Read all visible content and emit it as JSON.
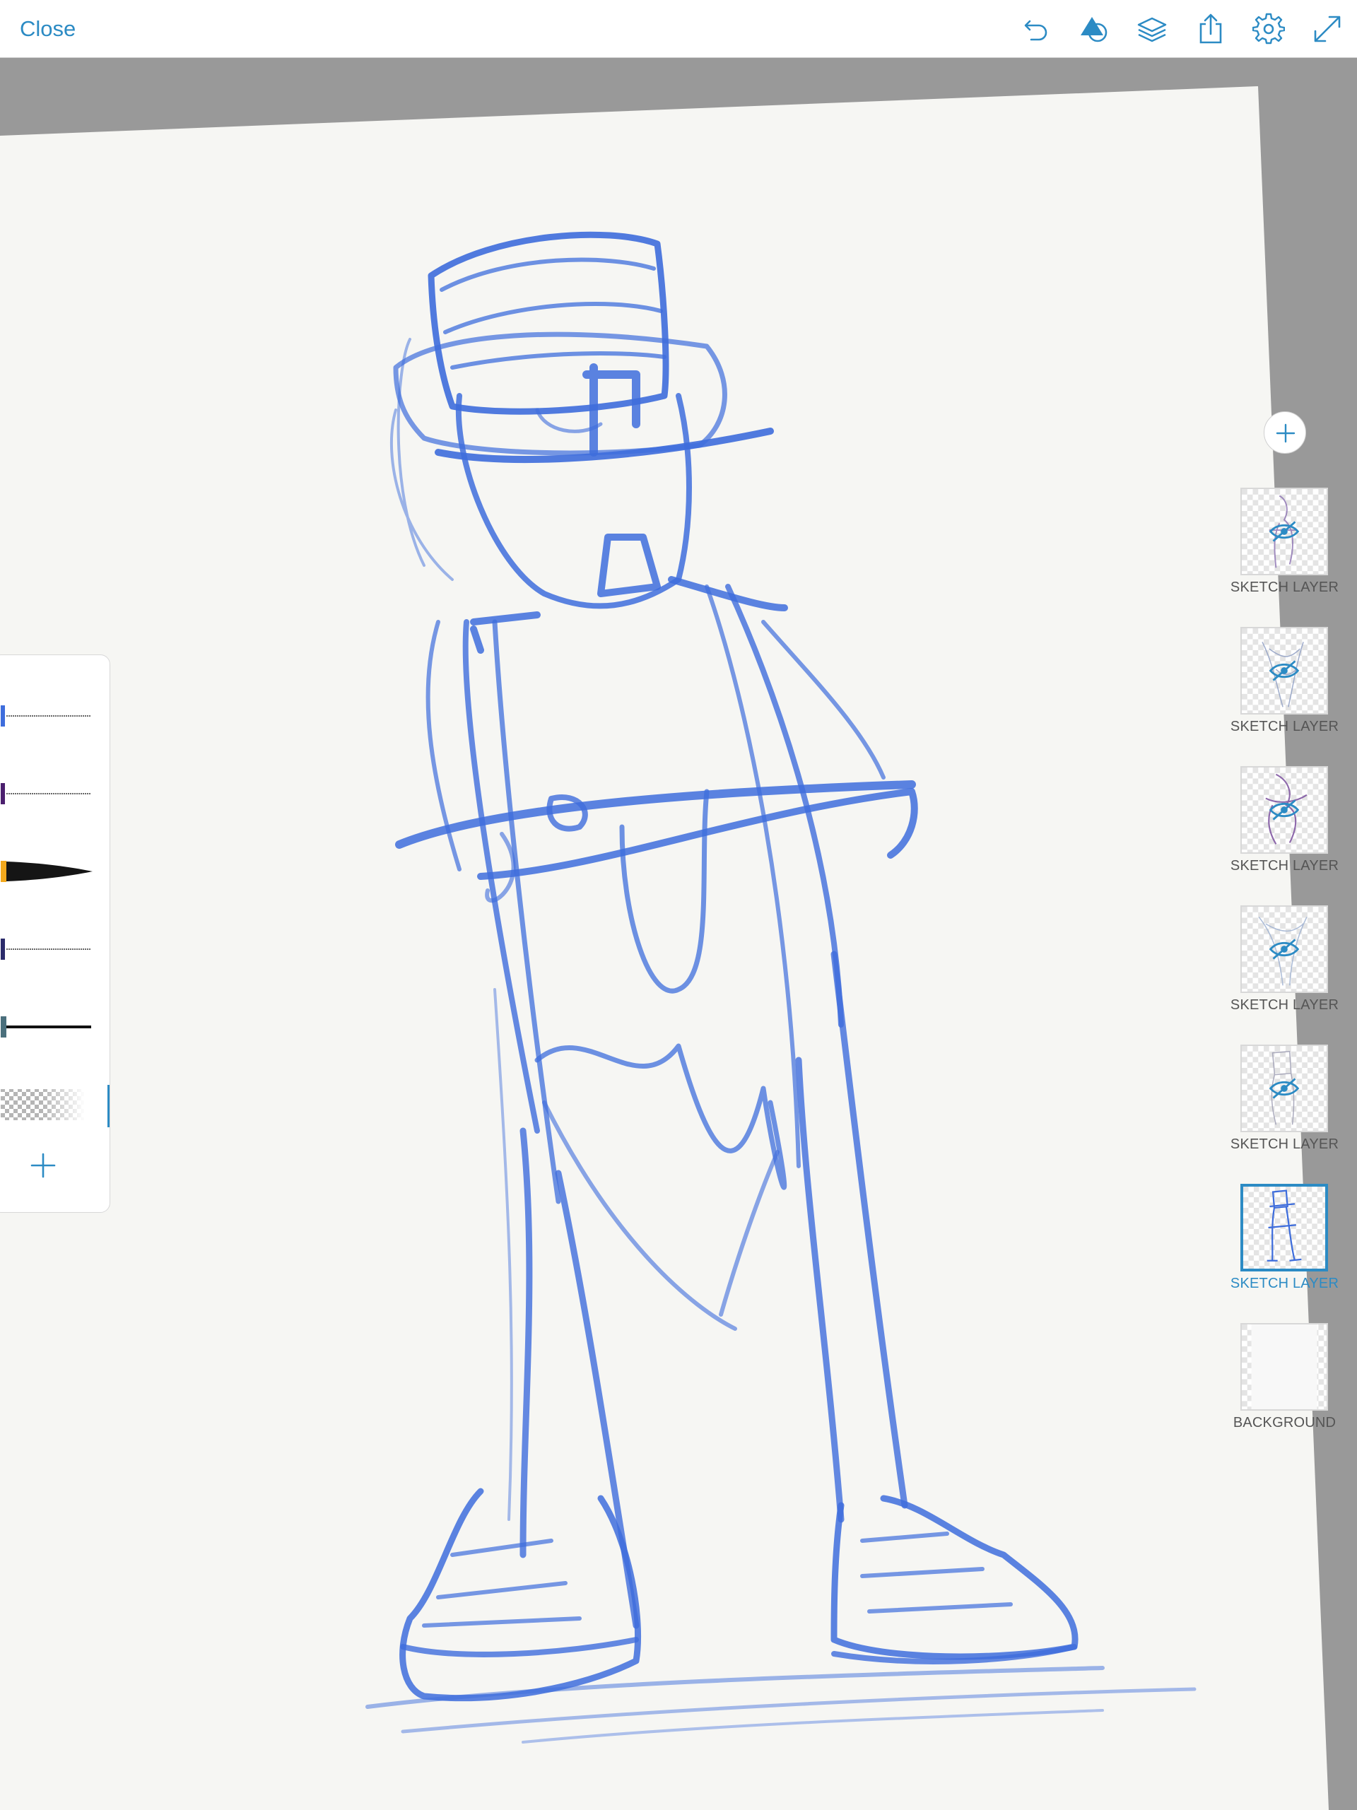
{
  "app": {
    "accent_color": "#2c8bc4",
    "canvas_color": "#f6f6f3",
    "stroke_color": "#3e6ddc"
  },
  "topbar": {
    "close_label": "Close",
    "tools": [
      {
        "icon": "undo-icon"
      },
      {
        "icon": "shapes-icon"
      },
      {
        "icon": "layers-icon"
      },
      {
        "icon": "share-icon"
      },
      {
        "icon": "settings-gear-icon"
      },
      {
        "icon": "fullscreen-expand-icon"
      }
    ]
  },
  "brush_panel": {
    "brushes": [
      {
        "icon": "pencil-brush-icon",
        "color": "#3e6ddc"
      },
      {
        "icon": "pencil-brush-icon",
        "color": "#4b1f6e"
      },
      {
        "icon": "ink-brush-icon",
        "color": "#f2a81d"
      },
      {
        "icon": "pencil-brush-icon",
        "color": "#2b2b6b"
      },
      {
        "icon": "line-brush-icon",
        "color": "#4a6f7c"
      },
      {
        "icon": "eraser-brush-icon",
        "color": "#9a9a9a"
      }
    ],
    "add_icon": "plus-icon"
  },
  "layers_panel": {
    "add_icon": "plus-icon",
    "layers": [
      {
        "name": "SKETCH LAYER",
        "hidden": true,
        "active": false
      },
      {
        "name": "SKETCH LAYER",
        "hidden": true,
        "active": false
      },
      {
        "name": "SKETCH LAYER",
        "hidden": true,
        "active": false
      },
      {
        "name": "SKETCH LAYER",
        "hidden": true,
        "active": false
      },
      {
        "name": "SKETCH LAYER",
        "hidden": true,
        "active": false
      },
      {
        "name": "SKETCH LAYER",
        "hidden": false,
        "active": true
      },
      {
        "name": "BACKGROUND",
        "hidden": false,
        "active": false
      }
    ]
  }
}
